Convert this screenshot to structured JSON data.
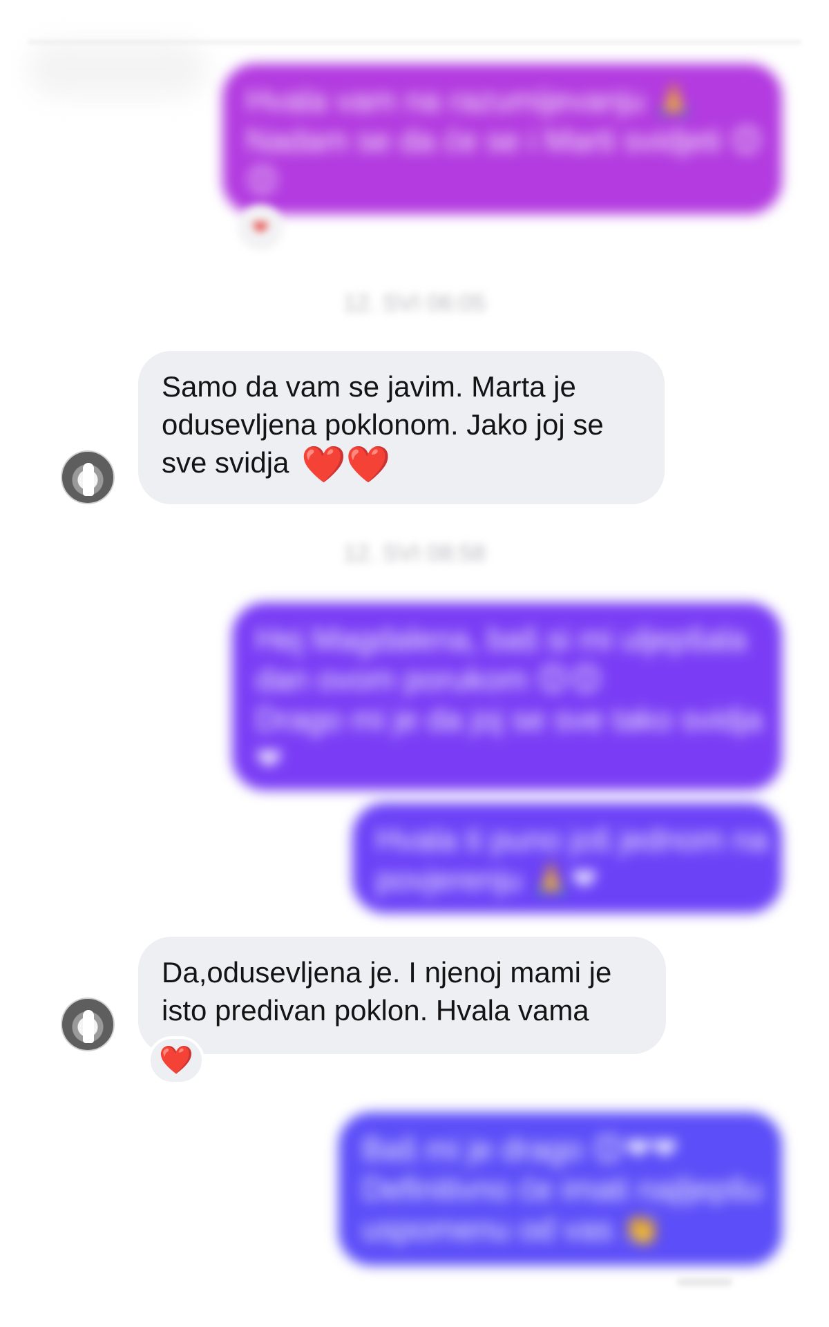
{
  "conversation": {
    "sent_messages": [
      {
        "lines": [
          "Hvala vam na razumijevanju 🙏",
          "Nadam se da će se i Marti svidjeti 😊",
          "😊"
        ],
        "reaction": "❤"
      },
      {
        "lines": [
          "Hej Magdalena, baš si mi uljepšala",
          "dan ovom porukom 😊😊",
          "Drago mi je da joj se sve tako svidja",
          "❤"
        ]
      },
      {
        "lines": [
          "Hvala ti puno još jednom na",
          "povjerenju 🙏❤"
        ]
      },
      {
        "lines": [
          "Baš mi je drago 😊❤❤",
          "Definitivno će imati najljepšu",
          "uspomenu od vas 👏"
        ]
      }
    ],
    "timestamps": [
      "12. SVI 06:05",
      "12. SVI 08:58"
    ],
    "received_messages": [
      {
        "lines": [
          "Samo da vam se javim. Marta je",
          "odusevljena poklonom. Jako joj se",
          "sve svidja"
        ],
        "hearts": "❤️❤️"
      },
      {
        "lines": [
          "Da,odusevljena je. I njenoj mami je",
          "isto predivan poklon. Hvala vama"
        ],
        "reaction": "❤️"
      }
    ]
  },
  "colors": {
    "sent_bubble_1": "#b33be0",
    "sent_bubble_2": "#7a3df5",
    "sent_bubble_3": "#6c42f7",
    "sent_bubble_4": "#5c4ef8",
    "received_bubble": "#eeeff3",
    "heart": "#e0242b"
  }
}
